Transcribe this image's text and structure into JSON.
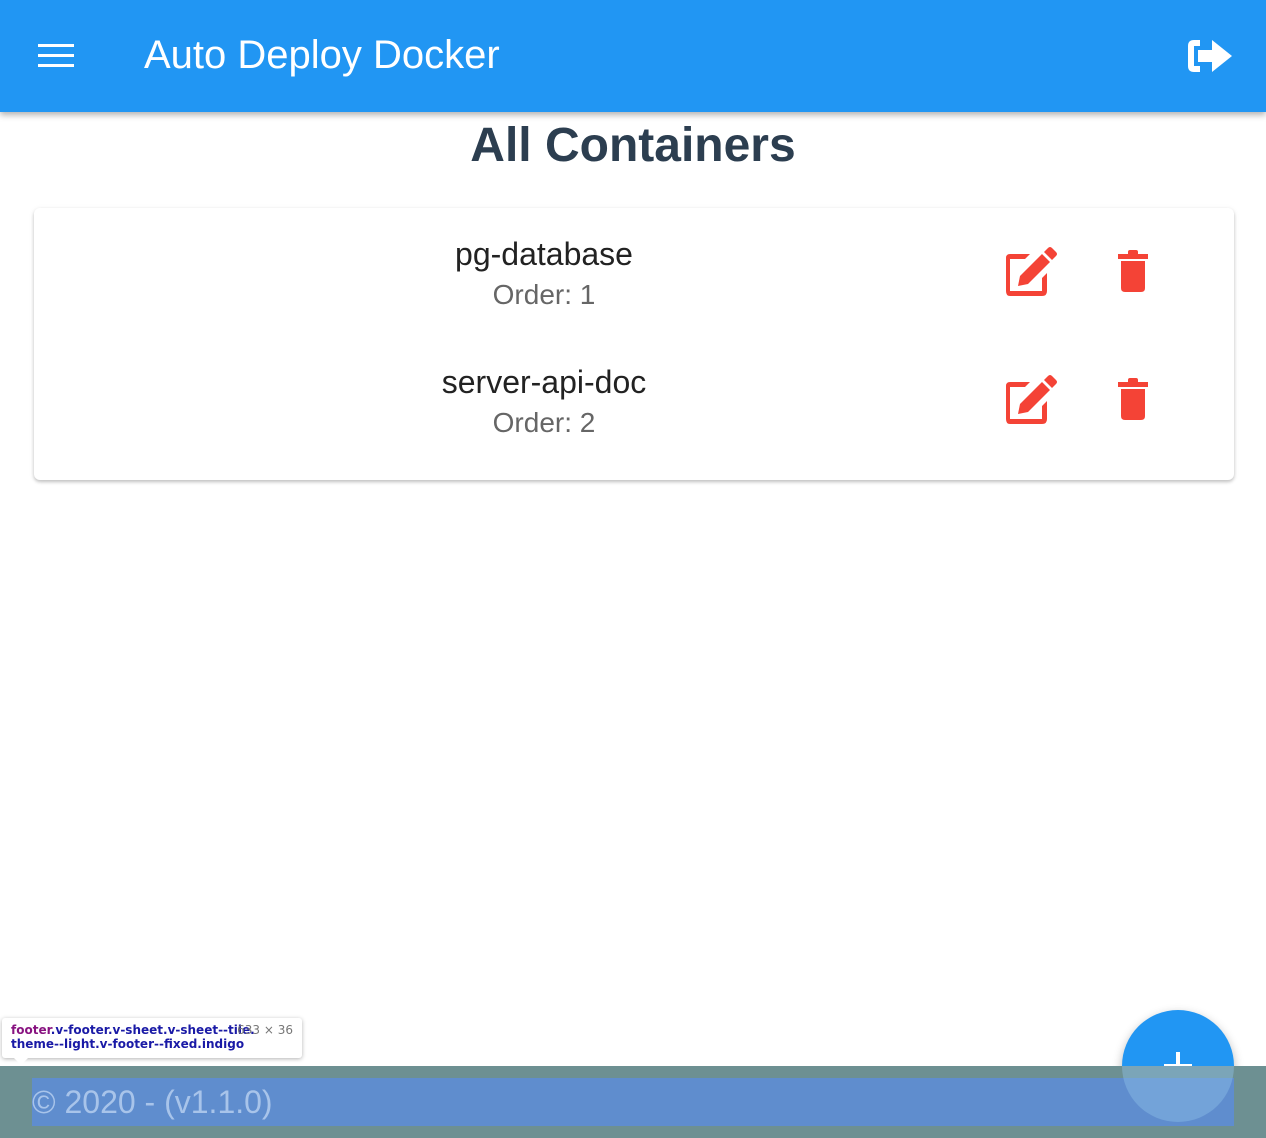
{
  "app_bar": {
    "title": "Auto Deploy Docker",
    "menu_icon": "hamburger-menu-icon",
    "logout_icon": "sign-out-icon",
    "color": "#2196f3"
  },
  "page": {
    "title": "All Containers"
  },
  "containers": [
    {
      "name": "pg-database",
      "order_label": "Order: 1",
      "edit_icon": "edit-icon",
      "delete_icon": "trash-icon"
    },
    {
      "name": "server-api-doc",
      "order_label": "Order: 2",
      "edit_icon": "edit-icon",
      "delete_icon": "trash-icon"
    }
  ],
  "actions_color": "#f44336",
  "footer": {
    "text": "© 2020 - (v1.1.0)"
  },
  "fab": {
    "icon": "plus-icon",
    "color": "#2196f3"
  },
  "devtools_tooltip": {
    "tag": "footer",
    "classes_line1": ".v-footer.v-sheet.v-sheet--tile.",
    "classes_line2": "theme--light.v-footer--fixed.indigo",
    "size": "633 × 36"
  }
}
